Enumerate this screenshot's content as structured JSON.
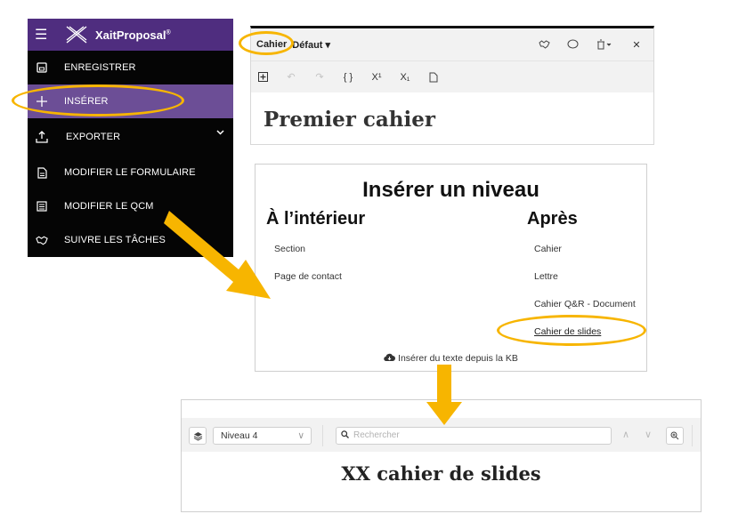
{
  "sidebar": {
    "brand": "XaitProposal",
    "brand_mark": "®",
    "items": [
      {
        "label": "ENREGISTRER",
        "icon": "save-icon"
      },
      {
        "label": "INSÉRER",
        "icon": "plus-icon"
      },
      {
        "label": "EXPORTER",
        "icon": "export-icon"
      },
      {
        "label": "MODIFIER LE FORMULAIRE",
        "icon": "form-icon"
      },
      {
        "label": "MODIFIER LE QCM",
        "icon": "checklist-icon"
      },
      {
        "label": "SUIVRE LES TÂCHES",
        "icon": "handshake-icon"
      }
    ]
  },
  "editor": {
    "tab": "Cahier",
    "view": "Défaut",
    "title": "Premier cahier"
  },
  "dialog": {
    "title": "Insérer un niveau",
    "inside_heading": "À l’intérieur",
    "after_heading": "Après",
    "inside_options": [
      "Section",
      "Page de contact"
    ],
    "after_options": [
      "Cahier",
      "Lettre",
      "Cahier Q&R - Document",
      "Cahier de slides"
    ],
    "kb_link": "Insérer du texte depuis la KB"
  },
  "bottom": {
    "level": "Niveau 4",
    "search_placeholder": "Rechercher",
    "title": "XX cahier de slides"
  },
  "colors": {
    "accent_purple": "#4f2d7f",
    "active_item": "#6c4e96",
    "highlight": "#f7b500"
  }
}
